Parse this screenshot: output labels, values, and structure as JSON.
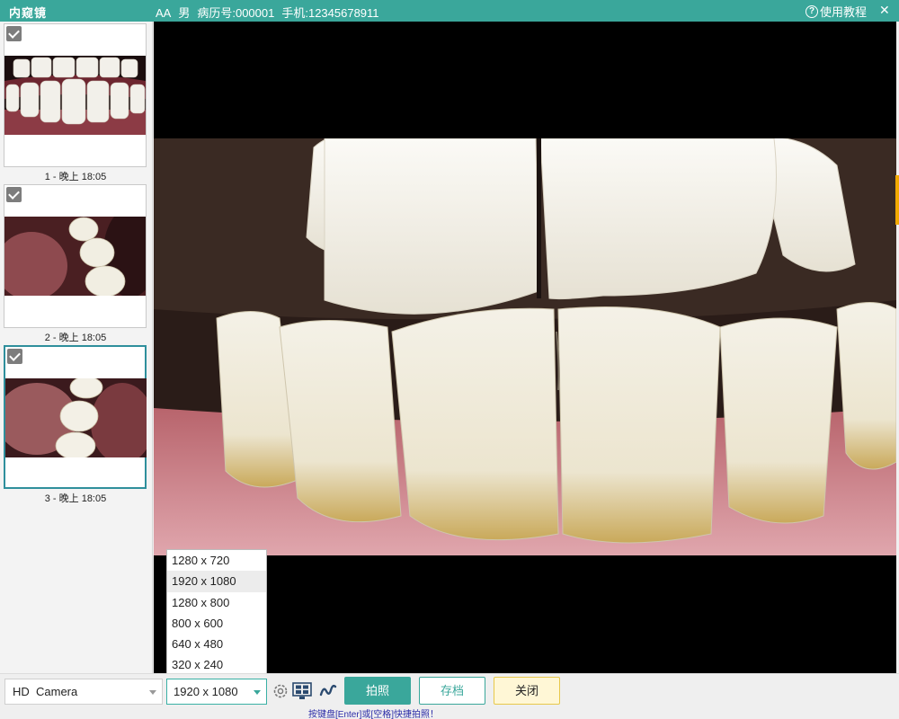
{
  "titlebar": {
    "app_title": "内窥镜",
    "patient_name": "AA",
    "patient_gender": "男",
    "record_no": "病历号:000001",
    "phone": "手机:12345678911",
    "help_label": "使用教程",
    "close_glyph": "✕"
  },
  "thumbnails": [
    {
      "caption": "1 - 晚上 18:05",
      "checked": true,
      "selected": false
    },
    {
      "caption": "2 - 晚上 18:05",
      "checked": true,
      "selected": false
    },
    {
      "caption": "3 - 晚上 18:05",
      "checked": true,
      "selected": true
    }
  ],
  "resolution_options": [
    "1280 x 720",
    "1920 x 1080",
    "1280 x 800",
    "800 x 600",
    "640 x 480",
    "320 x 240"
  ],
  "toolbar": {
    "camera_value": "HD  Camera",
    "resolution_value": "1920 x 1080",
    "capture_label": "拍照",
    "archive_label": "存档",
    "close_label": "关闭",
    "hint": "按键盘[Enter]或[空格]快捷拍照！"
  },
  "icons": {
    "settings": "gear-icon",
    "monitor": "monitor-grid-icon",
    "wave": "curve-icon"
  },
  "colors": {
    "accent": "#3aa79b",
    "close_button_bg": "#fff7d6",
    "hint_text": "#2c2ca8"
  }
}
